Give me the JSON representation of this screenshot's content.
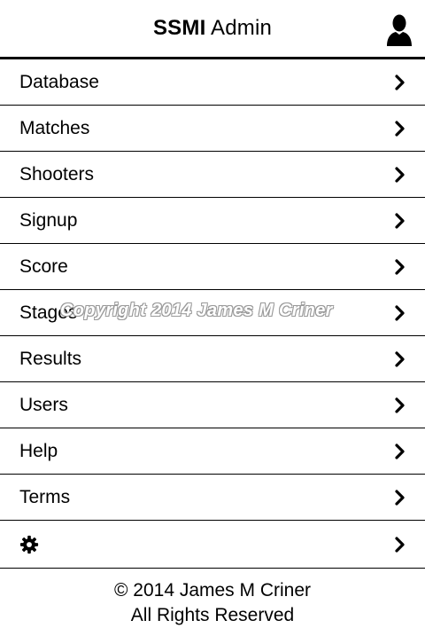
{
  "header": {
    "brand": "SSMI",
    "title_suffix": "Admin",
    "user_icon": "user-silhouette-icon"
  },
  "menu": {
    "items": [
      {
        "label": "Database"
      },
      {
        "label": "Matches"
      },
      {
        "label": "Shooters"
      },
      {
        "label": "Signup"
      },
      {
        "label": "Score"
      },
      {
        "label": "Stages"
      },
      {
        "label": "Results"
      },
      {
        "label": "Users"
      },
      {
        "label": "Help"
      },
      {
        "label": "Terms"
      }
    ],
    "settings_icon": "gear-icon",
    "chevron_icon": "chevron-right-icon"
  },
  "watermark": "Copyright 2014 James M Criner",
  "footer": {
    "line1": "© 2014 James M Criner",
    "line2": "All Rights Reserved"
  }
}
